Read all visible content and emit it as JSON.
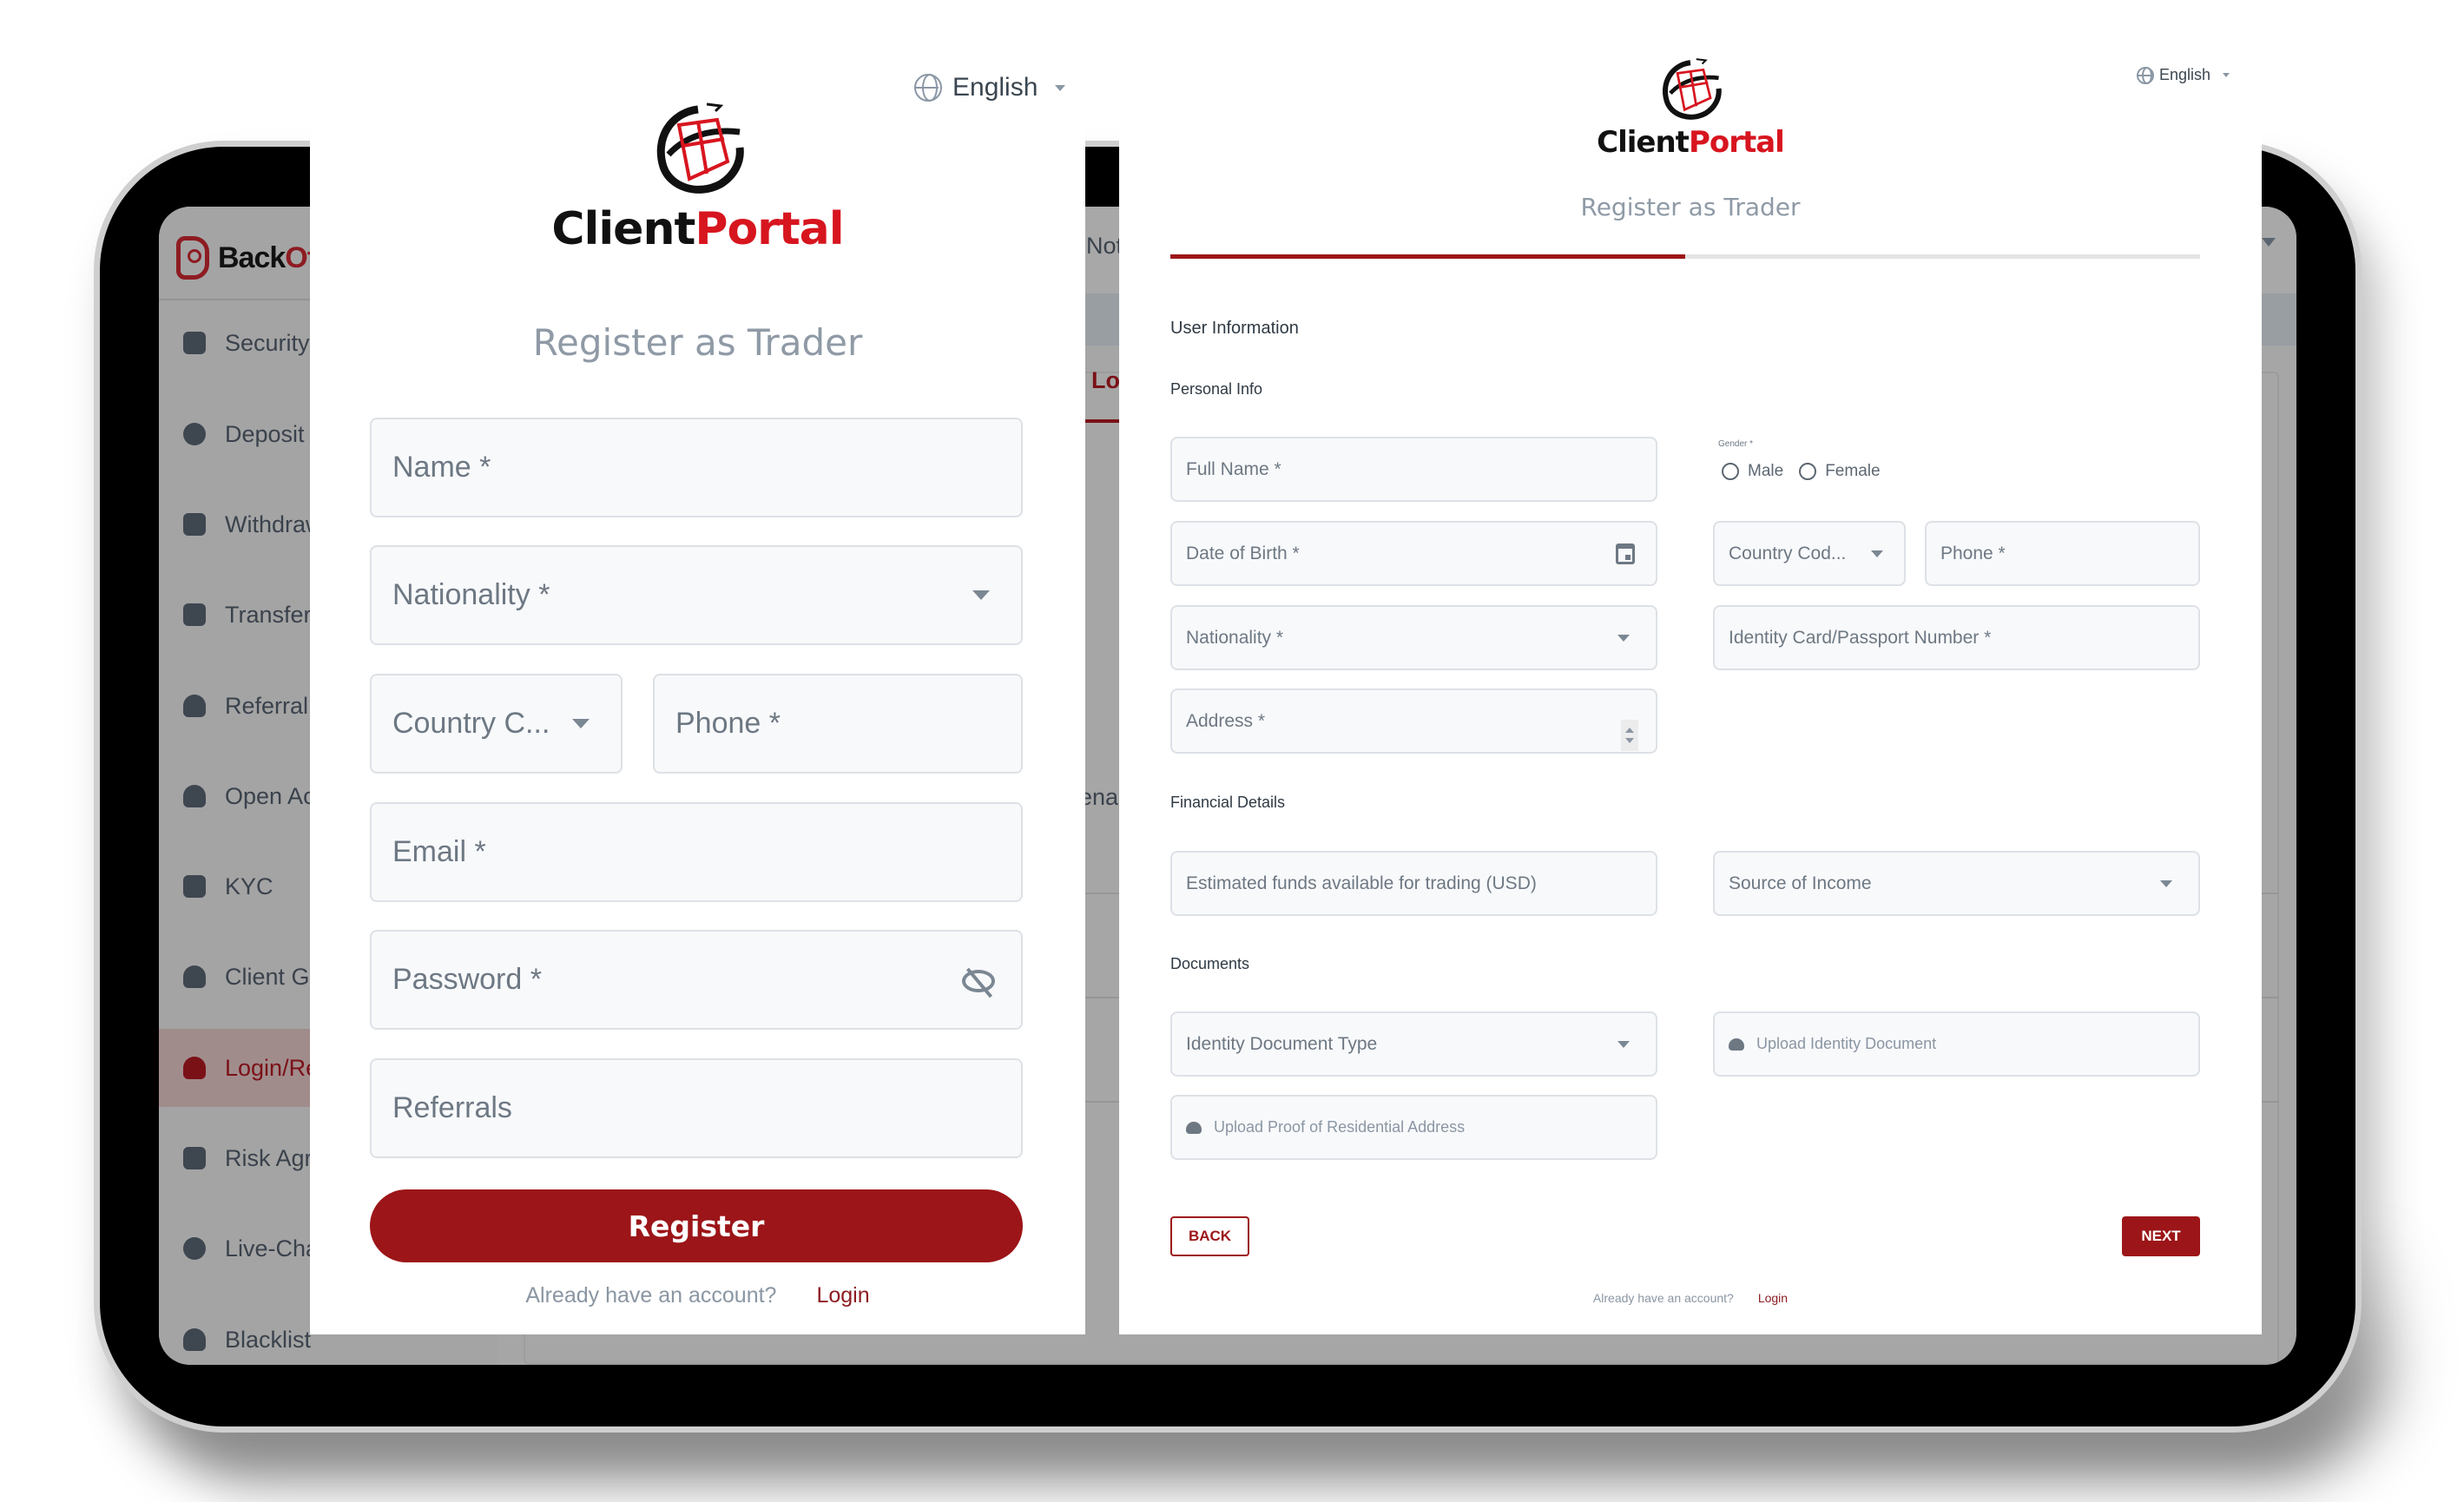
{
  "backoffice": {
    "logo": {
      "text_primary": "Back",
      "text_accent": "Of"
    },
    "sidebar": {
      "items": [
        {
          "label": "Security S",
          "icon": "shield-icon",
          "active": false
        },
        {
          "label": "Deposit S",
          "icon": "money-bag-icon",
          "active": false
        },
        {
          "label": "Withdrawa",
          "icon": "wallet-icon",
          "active": false
        },
        {
          "label": "Transfer S",
          "icon": "transfer-icon",
          "active": false
        },
        {
          "label": "Referral F",
          "icon": "users-icon",
          "active": false
        },
        {
          "label": "Open Acc",
          "icon": "user-cog-icon",
          "active": false
        },
        {
          "label": "KYC",
          "icon": "id-card-icon",
          "active": false
        },
        {
          "label": "Client Gro",
          "icon": "group-icon",
          "active": false
        },
        {
          "label": "Login/Reg",
          "icon": "user-cog-icon",
          "active": true
        },
        {
          "label": "Risk Agre",
          "icon": "document-warning-icon",
          "active": false
        },
        {
          "label": "Live-Chat",
          "icon": "chat-icon",
          "active": false
        },
        {
          "label": "Blacklist",
          "icon": "user-block-icon",
          "active": false
        }
      ]
    },
    "peek": {
      "topbar": "Not",
      "tab": "Log",
      "content": "enab"
    }
  },
  "left_form": {
    "language": "English",
    "logo": {
      "text_primary": "Client",
      "text_accent": "Portal"
    },
    "title": "Register as Trader",
    "fields": {
      "name": "Name *",
      "nationality": "Nationality *",
      "country_code": "Country C...",
      "phone": "Phone *",
      "email": "Email *",
      "password": "Password *",
      "referrals": "Referrals"
    },
    "register_label": "Register",
    "footer": {
      "question": "Already have an account?",
      "login": "Login"
    }
  },
  "right_form": {
    "language": "English",
    "logo": {
      "text_primary": "Client",
      "text_accent": "Portal"
    },
    "title": "Register as Trader",
    "progress": {
      "step": 1,
      "total_steps": 2,
      "fraction": 0.5
    },
    "sections": {
      "user_information": "User Information",
      "personal_info": "Personal Info",
      "financial_details": "Financial Details",
      "documents": "Documents"
    },
    "fields": {
      "full_name": "Full Name *",
      "gender_label": "Gender *",
      "gender_options": [
        "Male",
        "Female"
      ],
      "date_of_birth": "Date of Birth *",
      "country_code": "Country Cod...",
      "phone": "Phone *",
      "nationality": "Nationality *",
      "identity_number": "Identity Card/Passport Number *",
      "address": "Address *",
      "estimated_funds": "Estimated funds available for trading (USD)",
      "source_of_income": "Source of Income",
      "identity_document_type": "Identity Document Type",
      "upload_identity": "Upload  Identity Document",
      "upload_address": "Upload  Proof of Residential Address"
    },
    "back_label": "BACK",
    "next_label": "NEXT",
    "footer": {
      "question": "Already have an account?",
      "login": "Login"
    }
  },
  "colors": {
    "brand_red": "#9c1518",
    "logo_red": "#d7151f",
    "field_bg": "#f8f9fb",
    "title_grey": "#8f9aa6"
  }
}
